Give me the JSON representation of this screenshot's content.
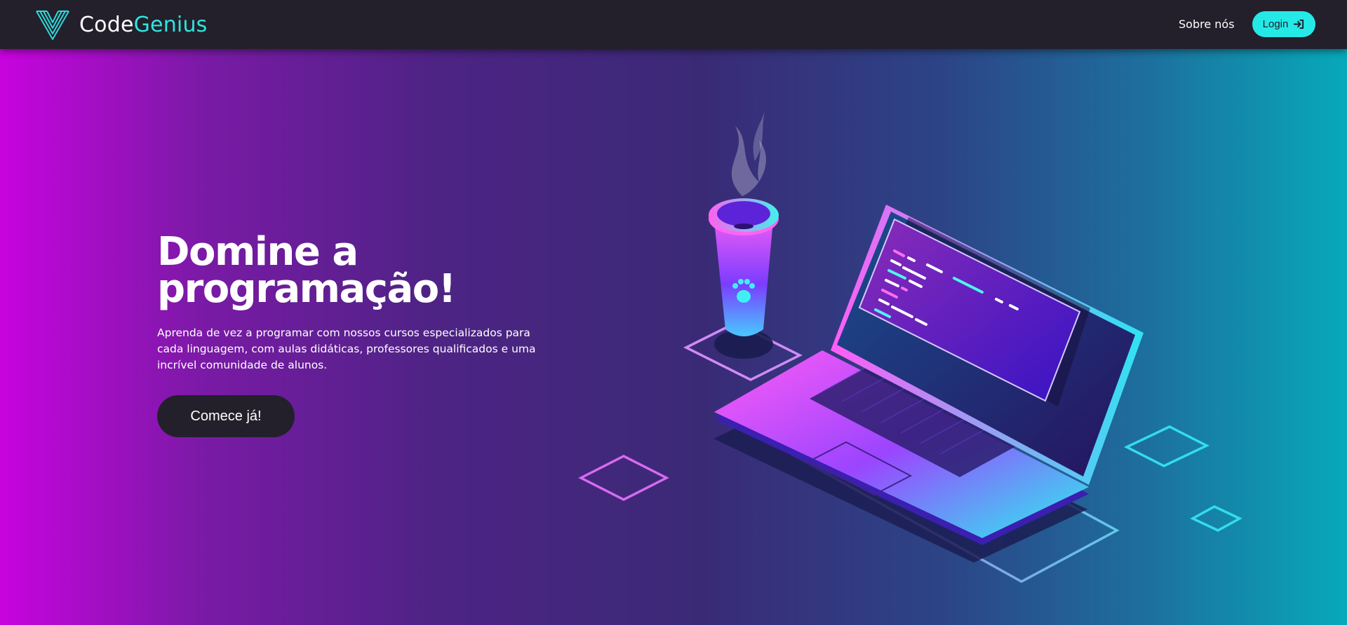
{
  "header": {
    "brand": {
      "part1": "Code",
      "part2": "Genius"
    },
    "nav": {
      "about": "Sobre nós",
      "login": "Login"
    }
  },
  "hero": {
    "title_line1": "Domine a",
    "title_line2": "programação!",
    "description": "Aprenda de vez a programar com nossos cursos especializados para cada linguagem, com aulas didáticas, professores qualificados e uma incrível comunidade de alunos.",
    "cta": "Comece já!"
  },
  "icons": {
    "logo": "v-logo-icon",
    "login": "login-arrow-icon",
    "cup": "coffee-cup-icon",
    "paw": "paw-icon"
  },
  "colors": {
    "header_bg": "#23202b",
    "accent_cyan": "#25e9e6",
    "gradient_left": "#c803de",
    "gradient_right": "#07a9ba",
    "button_dark": "#23202b",
    "text": "#ffffff"
  }
}
